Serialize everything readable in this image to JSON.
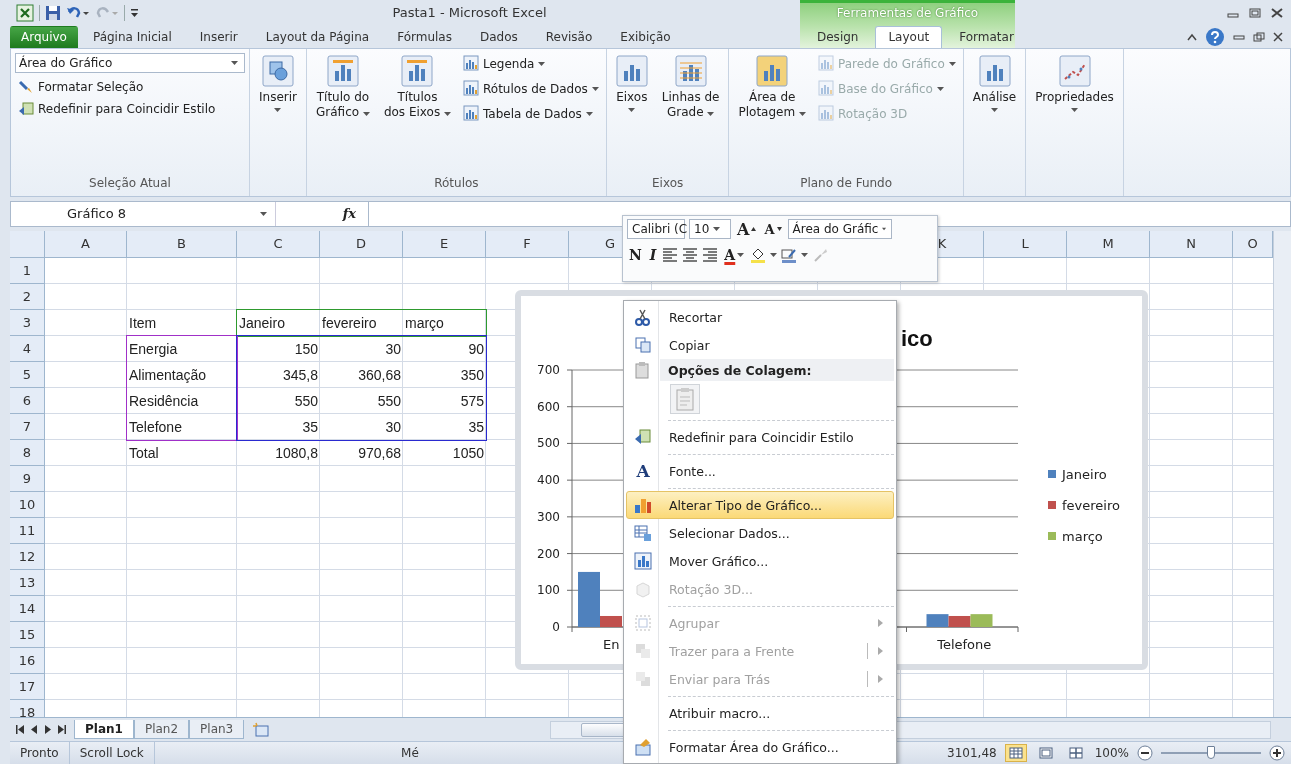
{
  "window": {
    "title": "Pasta1 - Microsoft Excel",
    "contextual_group": "Ferramentas de Gráfico"
  },
  "tabs": [
    {
      "label": "Arquivo",
      "kind": "file",
      "selected": false
    },
    {
      "label": "Página Inicial",
      "kind": "normal",
      "selected": false
    },
    {
      "label": "Inserir",
      "kind": "normal",
      "selected": false
    },
    {
      "label": "Layout da Página",
      "kind": "normal",
      "selected": false
    },
    {
      "label": "Fórmulas",
      "kind": "normal",
      "selected": false
    },
    {
      "label": "Dados",
      "kind": "normal",
      "selected": false
    },
    {
      "label": "Revisão",
      "kind": "normal",
      "selected": false
    },
    {
      "label": "Exibição",
      "kind": "normal",
      "selected": false
    },
    {
      "label": "Design",
      "kind": "contextual",
      "selected": false
    },
    {
      "label": "Layout",
      "kind": "contextual",
      "selected": true
    },
    {
      "label": "Formatar",
      "kind": "contextual",
      "selected": false
    }
  ],
  "ribbon": {
    "groups": [
      {
        "label": "Seleção Atual",
        "controls": [
          {
            "kind": "dropdown",
            "value": "Área do Gráfico"
          },
          {
            "kind": "small",
            "label": "Formatar Seleção",
            "disabled": false,
            "menu": false
          },
          {
            "kind": "small",
            "label": "Redefinir para Coincidir Estilo",
            "disabled": false,
            "menu": false
          }
        ]
      },
      {
        "controls": [
          {
            "kind": "large",
            "label": "Inserir",
            "menu": true
          }
        ]
      },
      {
        "label": "Rótulos",
        "controls": [
          {
            "kind": "large",
            "label": "Título do\nGráfico",
            "menu": true
          },
          {
            "kind": "large",
            "label": "Títulos\ndos Eixos",
            "menu": true
          },
          {
            "kind": "small",
            "label": "Legenda",
            "disabled": false,
            "menu": true
          },
          {
            "kind": "small",
            "label": "Rótulos de Dados",
            "disabled": false,
            "menu": true
          },
          {
            "kind": "small",
            "label": "Tabela de Dados",
            "disabled": false,
            "menu": true
          }
        ]
      },
      {
        "label": "Eixos",
        "controls": [
          {
            "kind": "large",
            "label": "Eixos",
            "menu": true
          },
          {
            "kind": "large",
            "label": "Linhas de\nGrade",
            "menu": true
          }
        ]
      },
      {
        "label": "Plano de Fundo",
        "controls": [
          {
            "kind": "large",
            "label": "Área de\nPlotagem",
            "menu": true
          },
          {
            "kind": "small",
            "label": "Parede do Gráfico",
            "disabled": true,
            "menu": true
          },
          {
            "kind": "small",
            "label": "Base do Gráfico",
            "disabled": true,
            "menu": true
          },
          {
            "kind": "small",
            "label": "Rotação 3D",
            "disabled": true,
            "menu": false
          }
        ]
      },
      {
        "controls": [
          {
            "kind": "large",
            "label": "Análise",
            "menu": true
          }
        ]
      },
      {
        "controls": [
          {
            "kind": "large",
            "label": "Propriedades",
            "menu": true
          }
        ]
      }
    ]
  },
  "formula_bar": {
    "name_box": "Gráfico 8",
    "fx": "fx"
  },
  "sheet": {
    "columns": [
      "A",
      "B",
      "C",
      "D",
      "E",
      "F",
      "G",
      null,
      null,
      null,
      "K",
      "L",
      "M",
      "N",
      "O"
    ],
    "rows": [
      {
        "header": "1"
      },
      {
        "header": "2"
      },
      {
        "header": "3",
        "cells": [
          {
            "text": "Item",
            "kind": "text"
          },
          {
            "text": "Janeiro",
            "kind": "text"
          },
          {
            "text": "fevereiro",
            "kind": "text"
          },
          {
            "text": "março",
            "kind": "text"
          }
        ]
      },
      {
        "header": "4",
        "cells": [
          {
            "text": "Energia",
            "kind": "text"
          },
          {
            "text": "150",
            "kind": "number"
          },
          {
            "text": "30",
            "kind": "number"
          },
          {
            "text": "90",
            "kind": "number"
          }
        ]
      },
      {
        "header": "5",
        "cells": [
          {
            "text": "Alimentação",
            "kind": "text"
          },
          {
            "text": "345,8",
            "kind": "number"
          },
          {
            "text": "360,68",
            "kind": "number"
          },
          {
            "text": "350",
            "kind": "number"
          }
        ]
      },
      {
        "header": "6",
        "cells": [
          {
            "text": "Residência",
            "kind": "text"
          },
          {
            "text": "550",
            "kind": "number"
          },
          {
            "text": "550",
            "kind": "number"
          },
          {
            "text": "575",
            "kind": "number"
          }
        ]
      },
      {
        "header": "7",
        "cells": [
          {
            "text": "Telefone",
            "kind": "text"
          },
          {
            "text": "35",
            "kind": "number"
          },
          {
            "text": "30",
            "kind": "number"
          },
          {
            "text": "35",
            "kind": "number"
          }
        ]
      },
      {
        "header": "8",
        "cells": [
          {
            "text": "Total",
            "kind": "text"
          },
          {
            "text": "1080,8",
            "kind": "number"
          },
          {
            "text": "970,68",
            "kind": "number"
          },
          {
            "text": "1050",
            "kind": "number"
          }
        ]
      },
      {
        "header": "9"
      },
      {
        "header": "10"
      },
      {
        "header": "11"
      },
      {
        "header": "12"
      },
      {
        "header": "13"
      },
      {
        "header": "14"
      },
      {
        "header": "15"
      },
      {
        "header": "16"
      },
      {
        "header": "17"
      },
      {
        "header": "18"
      }
    ],
    "source_ranges": [
      {
        "kind": "series",
        "color": "#2e9a2e"
      },
      {
        "kind": "categories",
        "color": "#a030c8"
      },
      {
        "kind": "values",
        "color": "#2a2ad0"
      }
    ]
  },
  "chart": {
    "title": "ico",
    "chart_data": {
      "type": "bar",
      "categories": [
        "En",
        "Telefone"
      ],
      "ylim": [
        0,
        700
      ],
      "yticks": [
        0,
        100,
        200,
        300,
        400,
        500,
        600,
        700
      ],
      "grid": true,
      "legend": true,
      "series": [
        {
          "name": "Janeiro",
          "color": "#4f81bd",
          "values": [
            150,
            35
          ]
        },
        {
          "name": "fevereiro",
          "color": "#c0504d",
          "values": [
            30,
            30
          ]
        },
        {
          "name": "março",
          "color": "#9bbb59",
          "values": [
            null,
            35
          ]
        }
      ]
    }
  },
  "mini_toolbar": {
    "font": "Calibri (C",
    "size": "10",
    "grow": "A",
    "shrink": "A",
    "element": "Área do Gráfic",
    "bold": "N",
    "italic": "I",
    "font_color": "A"
  },
  "context_menu": [
    {
      "kind": "item",
      "label": "Recortar",
      "disabled": false,
      "selected": false
    },
    {
      "kind": "item",
      "label": "Copiar",
      "disabled": false,
      "selected": false
    },
    {
      "kind": "header",
      "label": "Opções de Colagem:"
    },
    {
      "kind": "paste"
    },
    {
      "kind": "separator"
    },
    {
      "kind": "item",
      "label": "Redefinir para Coincidir Estilo",
      "disabled": false,
      "selected": false
    },
    {
      "kind": "separator"
    },
    {
      "kind": "item",
      "label": "Fonte...",
      "icon_text": "A",
      "disabled": false,
      "selected": false
    },
    {
      "kind": "separator"
    },
    {
      "kind": "item",
      "label": "Alterar Tipo de Gráfico...",
      "disabled": false,
      "selected": true
    },
    {
      "kind": "item",
      "label": "Selecionar Dados...",
      "disabled": false,
      "selected": false
    },
    {
      "kind": "item",
      "label": "Mover Gráfico...",
      "disabled": false,
      "selected": false
    },
    {
      "kind": "item",
      "label": "Rotação 3D...",
      "disabled": true,
      "selected": false
    },
    {
      "kind": "separator"
    },
    {
      "kind": "item",
      "label": "Agrupar",
      "disabled": true,
      "selected": false,
      "submenu": true,
      "split": false
    },
    {
      "kind": "item",
      "label": "Trazer para a Frente",
      "disabled": true,
      "selected": false,
      "submenu": true,
      "split": true
    },
    {
      "kind": "item",
      "label": "Enviar para Trás",
      "disabled": true,
      "selected": false,
      "submenu": true,
      "split": true
    },
    {
      "kind": "separator"
    },
    {
      "kind": "item",
      "label": "Atribuir macro...",
      "disabled": false,
      "selected": false
    },
    {
      "kind": "separator"
    },
    {
      "kind": "item",
      "label": "Formatar Área do Gráfico...",
      "disabled": false,
      "selected": false
    }
  ],
  "sheet_tabs": [
    {
      "label": "Plan1",
      "selected": true
    },
    {
      "label": "Plan2",
      "selected": false
    },
    {
      "label": "Plan3",
      "selected": false
    }
  ],
  "status_bar": {
    "mode": "Pronto",
    "scroll_lock": "Scroll Lock",
    "average": "Mé",
    "sum": "3101,48",
    "views": [
      {
        "selected": true
      },
      {
        "selected": false
      },
      {
        "selected": false
      }
    ],
    "zoom": "100%",
    "zoom_slider": {
      "level": 0.5
    }
  }
}
